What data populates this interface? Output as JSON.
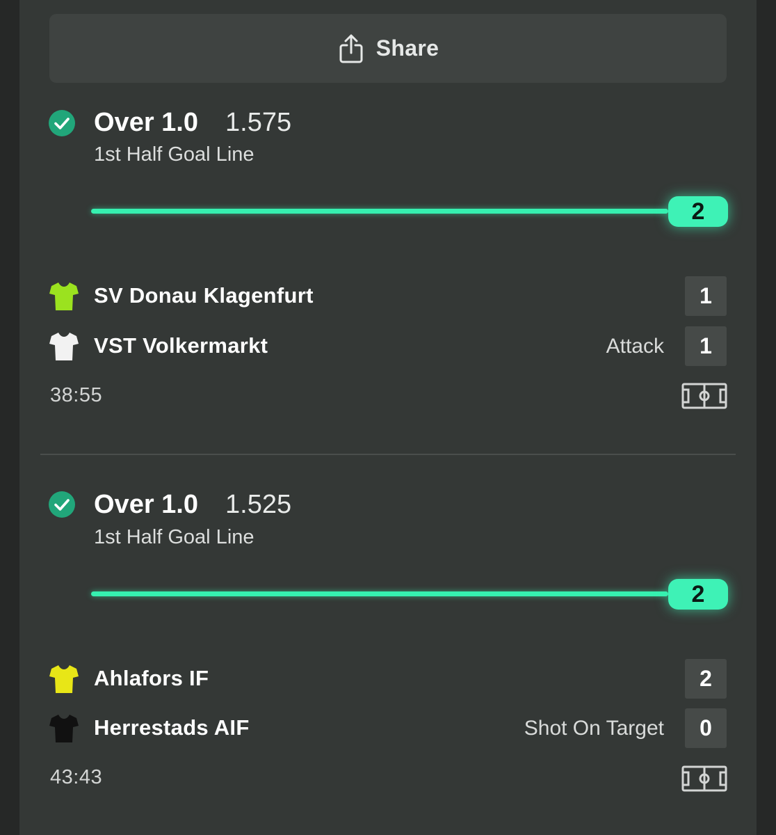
{
  "share": {
    "label": "Share",
    "icon": "share-icon"
  },
  "bets": [
    {
      "selection": "Over 1.0",
      "odds": "1.575",
      "market": "1st Half Goal Line",
      "status_icon": "check-circle-icon",
      "progress": {
        "value": "2",
        "fraction": 1.0
      },
      "teams": [
        {
          "name": "SV Donau Klagenfurt",
          "score": "1",
          "event": "",
          "shirt_color": "#9be21f"
        },
        {
          "name": "VST Volkermarkt",
          "score": "1",
          "event": "Attack",
          "shirt_color": "#f2f2f2"
        }
      ],
      "clock": "38:55"
    },
    {
      "selection": "Over 1.0",
      "odds": "1.525",
      "market": "1st Half Goal Line",
      "status_icon": "check-circle-icon",
      "progress": {
        "value": "2",
        "fraction": 1.0
      },
      "teams": [
        {
          "name": "Ahlafors IF",
          "score": "2",
          "event": "",
          "shirt_color": "#e8e617"
        },
        {
          "name": "Herrestads AIF",
          "score": "0",
          "event": "Shot On Target",
          "shirt_color": "#111111"
        }
      ],
      "clock": "43:43"
    }
  ],
  "colors": {
    "accent": "#3ef2b6",
    "check": "#21a67a",
    "panel": "#343836",
    "background": "#262827"
  }
}
